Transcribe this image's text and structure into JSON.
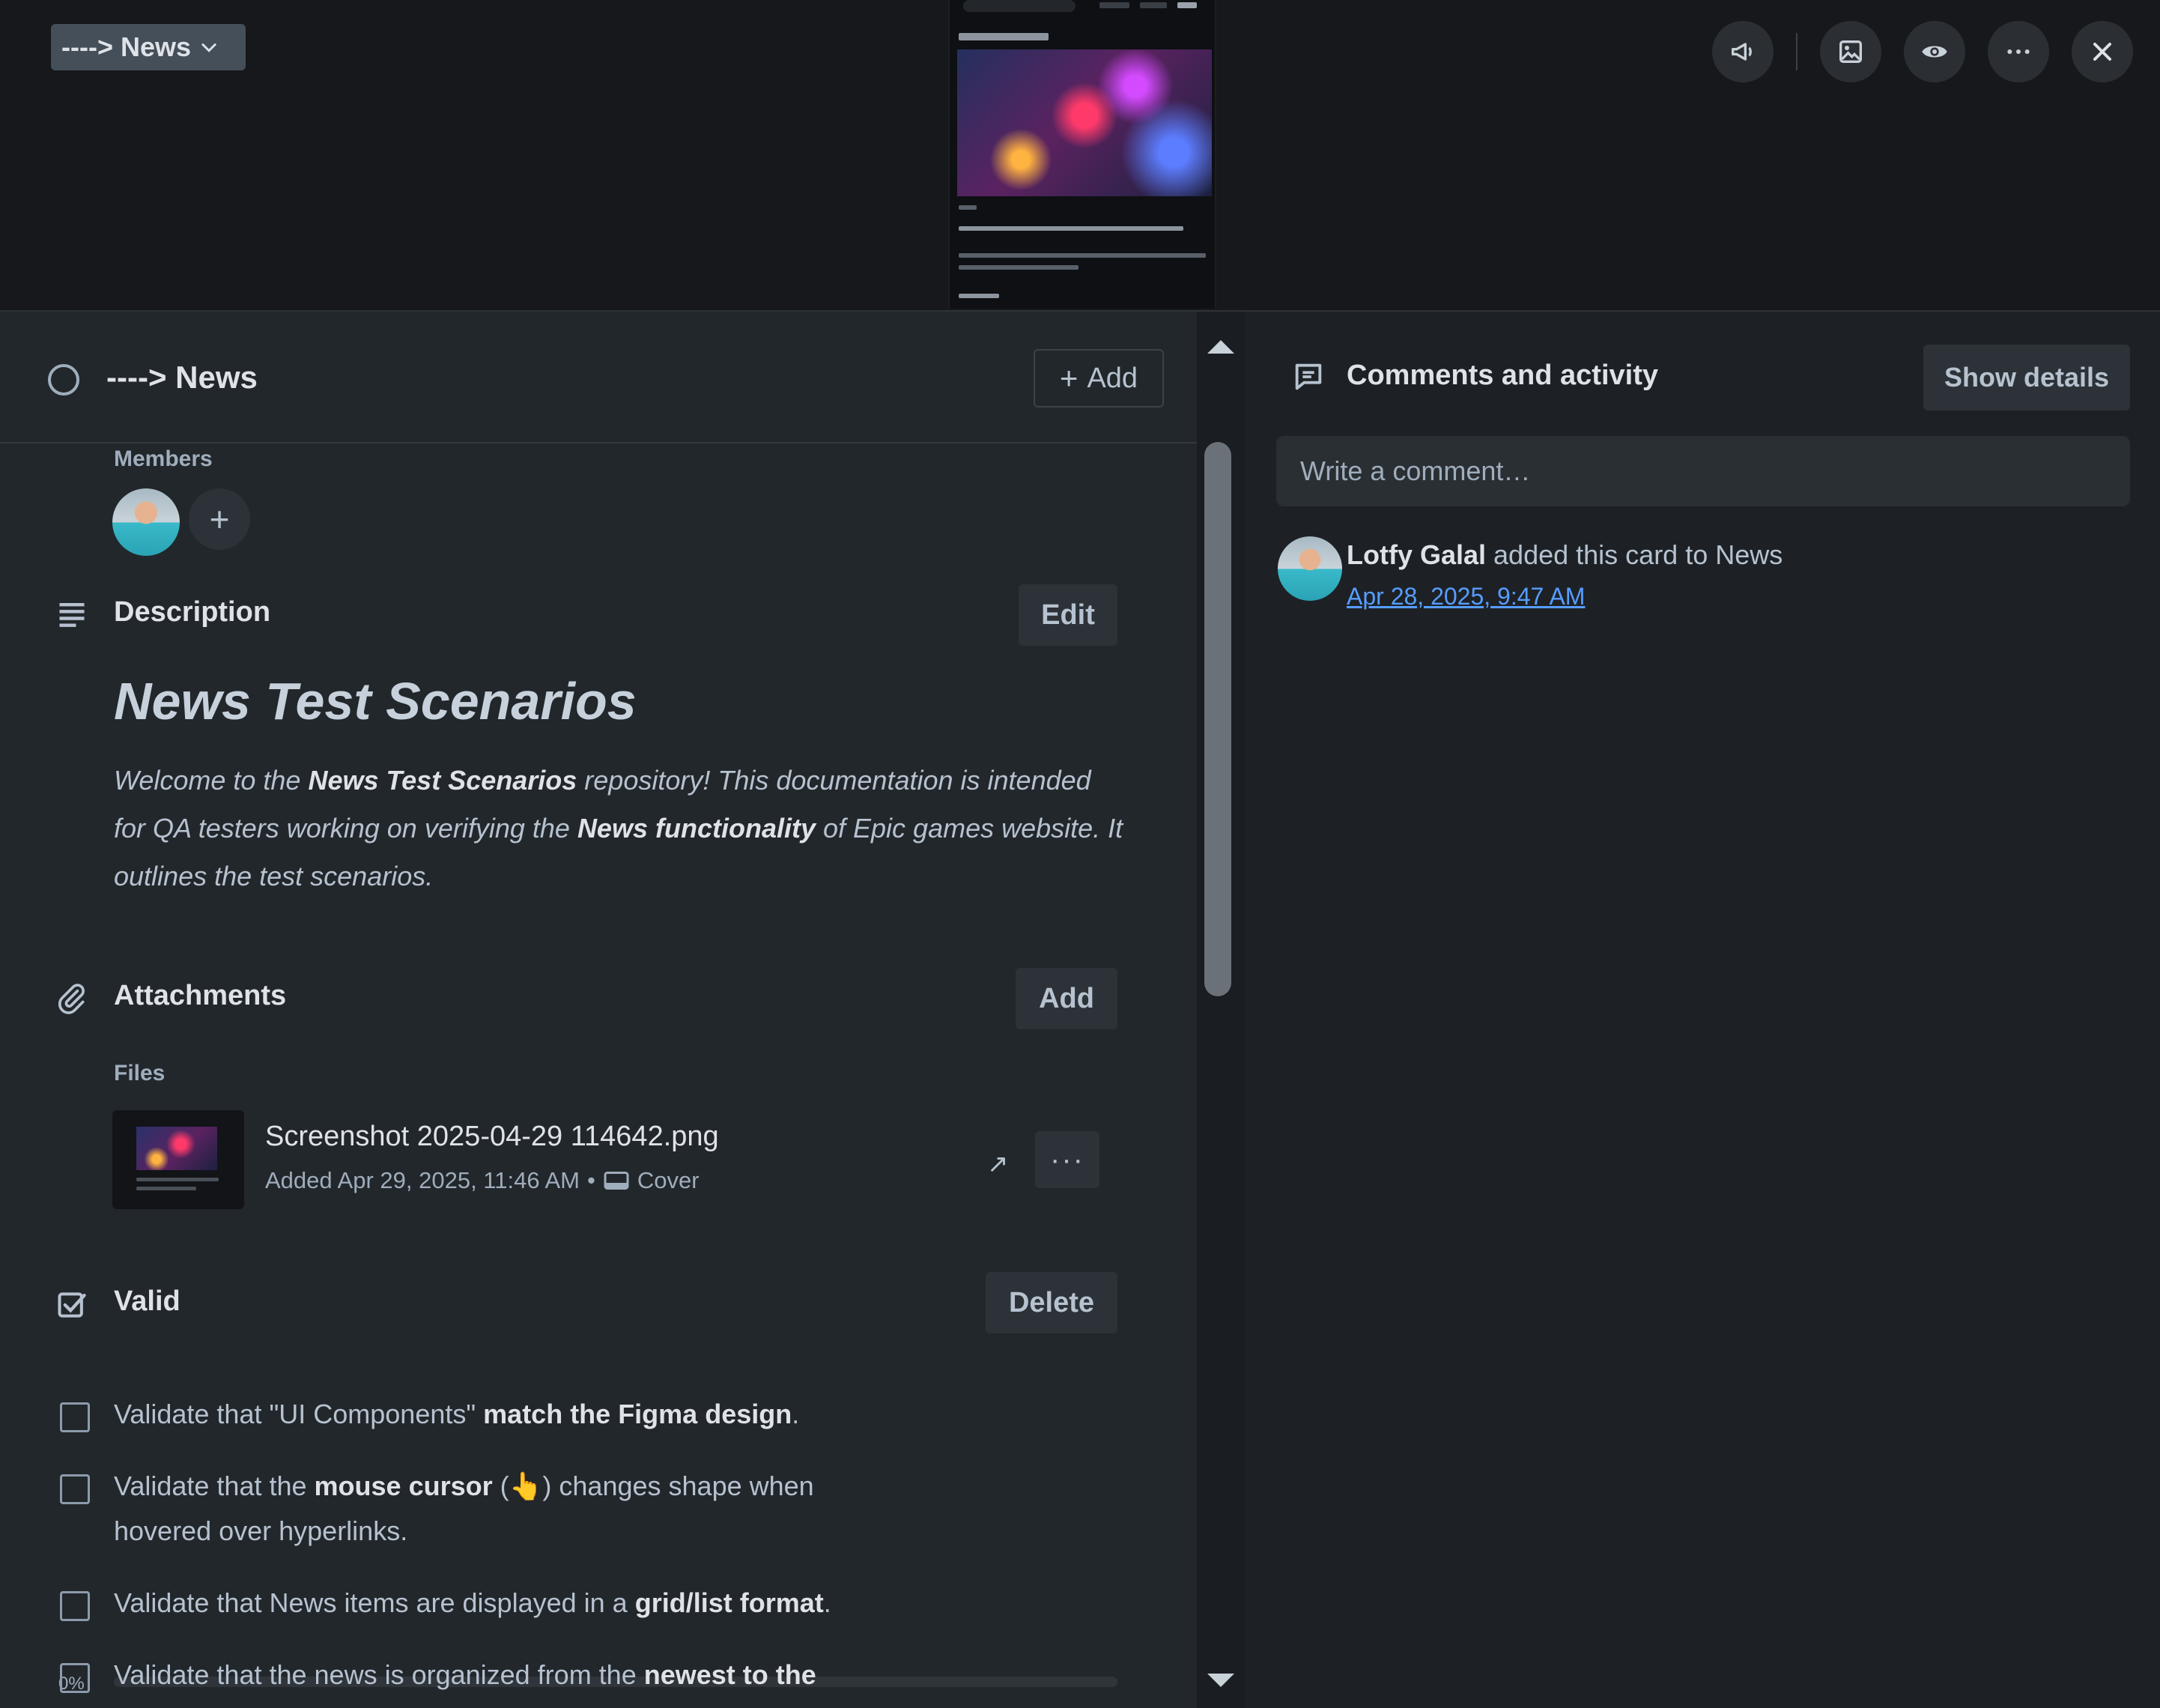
{
  "cover": {
    "list_chip_label": "----> News"
  },
  "card": {
    "title": "----> News",
    "add_label": "Add",
    "members_label": "Members",
    "add_member_symbol": "+"
  },
  "description": {
    "heading": "Description",
    "edit_label": "Edit",
    "doc_title": "News Test Scenarios",
    "para_1": "Welcome to the ",
    "para_bold_1": "News Test Scenarios",
    "para_2": " repository! This documentation is intended for QA testers working on verifying the ",
    "para_bold_2": "News functionality",
    "para_3": " of Epic games website. It outlines the test scenarios."
  },
  "attachments": {
    "heading": "Attachments",
    "add_label": "Add",
    "files_label": "Files",
    "file_name": "Screenshot 2025-04-29 114642.png",
    "file_added": "Added Apr 29, 2025, 11:46 AM",
    "file_sep": "•",
    "cover_label": "Cover",
    "open_symbol": "↗",
    "more_symbol": "···"
  },
  "checklist": {
    "heading": "Valid",
    "delete_label": "Delete",
    "progress_text": "0%",
    "progress_value": 0,
    "items": [
      {
        "a": "Validate that \"UI Components\" ",
        "b": "match the Figma design",
        "c": "."
      },
      {
        "a": "Validate that the ",
        "b": "mouse cursor",
        "c": " (👆) changes shape when hovered over hyperlinks."
      },
      {
        "a": "Validate that News items are displayed in a ",
        "b": "grid/list format",
        "c": "."
      },
      {
        "a": "Validate that the news is organized from the ",
        "b": "newest to the",
        "c": ""
      }
    ]
  },
  "activity": {
    "title": "Comments and activity",
    "show_details_label": "Show details",
    "comment_placeholder": "Write a comment…",
    "user_name": "Lotfy Galal",
    "action_text": " added this card to News",
    "date": "Apr 28, 2025, 9:47 AM"
  },
  "icons": {
    "header": [
      "megaphone-icon",
      "image-icon",
      "eye-icon",
      "more-icon",
      "close-icon"
    ]
  },
  "colors": {
    "accent": "#579dff",
    "panel": "#22272b",
    "side": "#1d2125"
  }
}
